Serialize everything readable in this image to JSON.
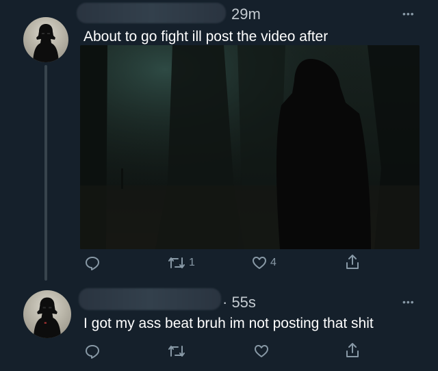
{
  "tweets": [
    {
      "time": "29m",
      "text": "About to go fight ill post the video after",
      "actions": {
        "reply": "",
        "retweet": "1",
        "like": "4",
        "share": ""
      }
    },
    {
      "time": "· 55s",
      "text": "I got my ass beat bruh im not posting that shit",
      "actions": {
        "reply": "",
        "retweet": "",
        "like": "",
        "share": ""
      }
    }
  ],
  "menu_icon": "more-dots-icon",
  "colors": {
    "background": "#15202b",
    "icon": "#8899a6",
    "thread_line": "#38444d",
    "text": "#ffffff"
  }
}
